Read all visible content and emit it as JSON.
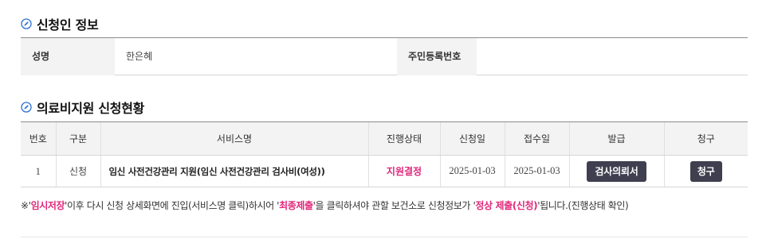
{
  "applicant_section": {
    "title": "신청인 정보",
    "name_label": "성명",
    "name_value": "한은혜",
    "rrn_label": "주민등록번호",
    "rrn_value": ""
  },
  "status_section": {
    "title": "의료비지원 신청현황",
    "columns": [
      "번호",
      "구분",
      "서비스명",
      "진행상태",
      "신청일",
      "접수일",
      "발급",
      "청구"
    ],
    "rows": [
      {
        "no": "1",
        "type": "신청",
        "service": "임신 사전건강관리 지원(임신 사전건강관리 검사비(여성))",
        "status": "지원결정",
        "applied": "2025-01-03",
        "received": "2025-01-03",
        "issue_button": "검사의뢰서",
        "claim_button": "청구"
      }
    ]
  },
  "notice": {
    "prefix": "※'",
    "temp_save": "임시저장",
    "part1": "'이후 다시 신청 상세화면에 진입(서비스명 클릭)하시어 '",
    "final_submit": "최종제출",
    "part2": "'을 클릭하셔야 관할 보건소로 신청정보가 '",
    "normal_submit": "정상 제출(신청)",
    "part3": "'됩니다.(진행상태 확인)"
  },
  "colors": {
    "accent_pink": "#e0287a",
    "button_dark": "#3f3f50",
    "icon_blue": "#2a6fd6"
  }
}
